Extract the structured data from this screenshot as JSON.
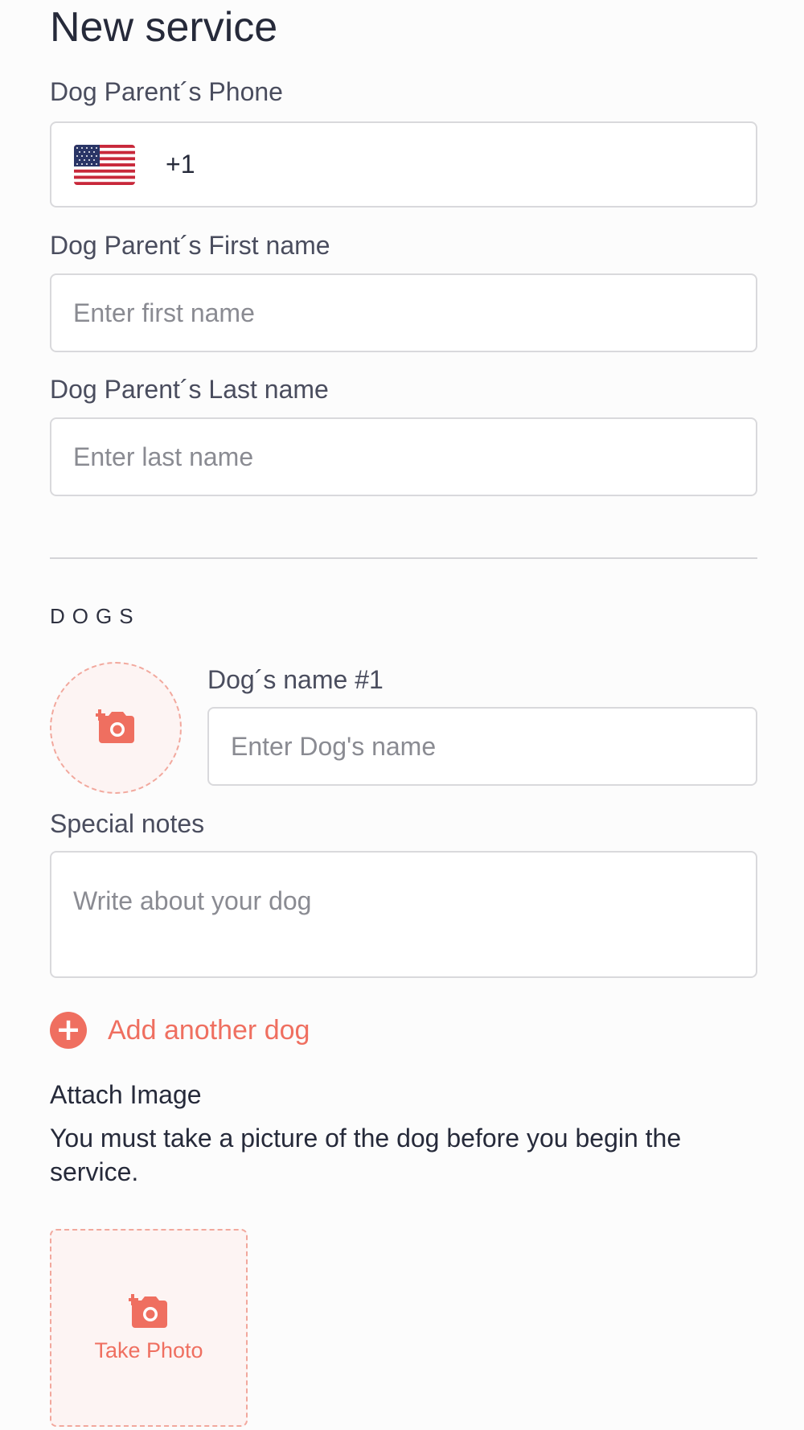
{
  "page": {
    "title": "New service"
  },
  "owner": {
    "phone_label": "Dog Parent´s Phone",
    "phone_code": "+1",
    "phone_flag_icon": "us-flag-icon",
    "first_name_label": "Dog Parent´s First name",
    "first_name_placeholder": "Enter first name",
    "last_name_label": "Dog Parent´s Last name",
    "last_name_placeholder": "Enter last name"
  },
  "dogs": {
    "section_title": "DOGS",
    "dog_name_label": "Dog´s name #1",
    "dog_name_placeholder": "Enter Dog's name",
    "avatar_icon": "add-photo-icon",
    "notes_label": "Special notes",
    "notes_placeholder": "Write about your dog",
    "add_another_label": "Add another dog",
    "add_icon": "plus-circle-icon"
  },
  "attach": {
    "title": "Attach Image",
    "description": "You must take a picture of the dog before you begin the service.",
    "take_photo_label": "Take Photo",
    "photo_icon": "add-photo-icon"
  },
  "colors": {
    "accent": "#ef6f60",
    "accent_light": "#fdf4f3",
    "text_dark": "#262a3a",
    "text_label": "#4a4d5e",
    "placeholder": "#8a8b92",
    "border": "#d9d9dc"
  }
}
